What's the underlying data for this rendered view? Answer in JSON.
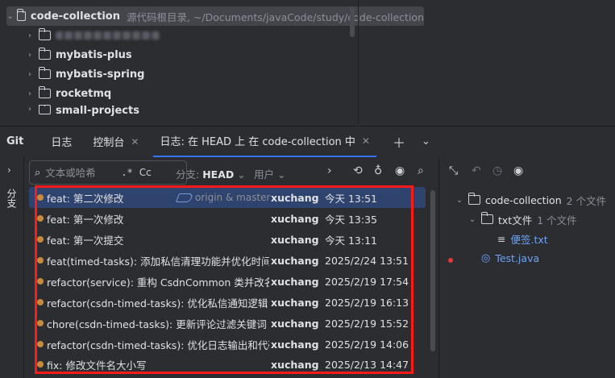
{
  "project": {
    "root": {
      "name": "code-collection",
      "path": "源代码根目录, ~/Documents/javaCode/study/code-collection"
    },
    "children": [
      {
        "name": ""
      },
      {
        "name": "mybatis-plus"
      },
      {
        "name": "mybatis-spring"
      },
      {
        "name": "rocketmq"
      },
      {
        "name": "small-projects"
      }
    ]
  },
  "toolwindow": {
    "title": "Git",
    "tabs": [
      {
        "label": "日志"
      },
      {
        "label": "控制台"
      },
      {
        "label": "日志: 在 HEAD 上 在 code-collection 中"
      }
    ],
    "add_icon": "plus-icon",
    "more_icon": "chevron-down-icon"
  },
  "left_strip": {
    "label": "分支"
  },
  "toolbar": {
    "search_placeholder": "文本或哈希",
    "regex": ".*",
    "match_case": "Cc",
    "branch_label": "分支:",
    "branch_value": "HEAD",
    "user_label": "用户"
  },
  "commits": [
    {
      "message": "feat: 第二次修改",
      "refs": "origin & master",
      "author": "xuchang",
      "date": "今天 13:51",
      "selected": true
    },
    {
      "message": "feat: 第一次修改",
      "refs": "",
      "author": "xuchang",
      "date": "今天 13:35"
    },
    {
      "message": "feat: 第一次提交",
      "refs": "",
      "author": "xuchang",
      "date": "今天 13:11"
    },
    {
      "message": "feat(timed-tasks): 添加私信清理功能并优化时间",
      "refs": "",
      "author": "xuchang",
      "date": "2025/2/24 13:51"
    },
    {
      "message": "refactor(service): 重构 CsdnCommon 类并改名",
      "refs": "",
      "author": "xuchang",
      "date": "2025/2/19 17:54"
    },
    {
      "message": "refactor(csdn-timed-tasks): 优化私信通知逻辑",
      "refs": "",
      "author": "xuchang",
      "date": "2025/2/19 16:13"
    },
    {
      "message": "chore(csdn-timed-tasks): 更新评论过滤关键词",
      "refs": "",
      "author": "xuchang",
      "date": "2025/2/19 15:52"
    },
    {
      "message": "refactor(csdn-timed-tasks): 优化日志输出和代码",
      "refs": "",
      "author": "xuchang",
      "date": "2025/2/19 14:06"
    },
    {
      "message": "fix: 修改文件名大小写",
      "refs": "",
      "author": "xuchang",
      "date": "2025/2/13 14:47"
    }
  ],
  "changes": {
    "root": {
      "name": "code-collection",
      "count": "2 个文件"
    },
    "folder": {
      "name": "txt文件",
      "count": "1 个文件"
    },
    "file1": {
      "name": "便签.txt"
    },
    "file2": {
      "name": "Test.java"
    }
  },
  "colors": {
    "accent": "#3574f0",
    "selection": "#2e436e",
    "highlight": "#ff1a1a"
  }
}
